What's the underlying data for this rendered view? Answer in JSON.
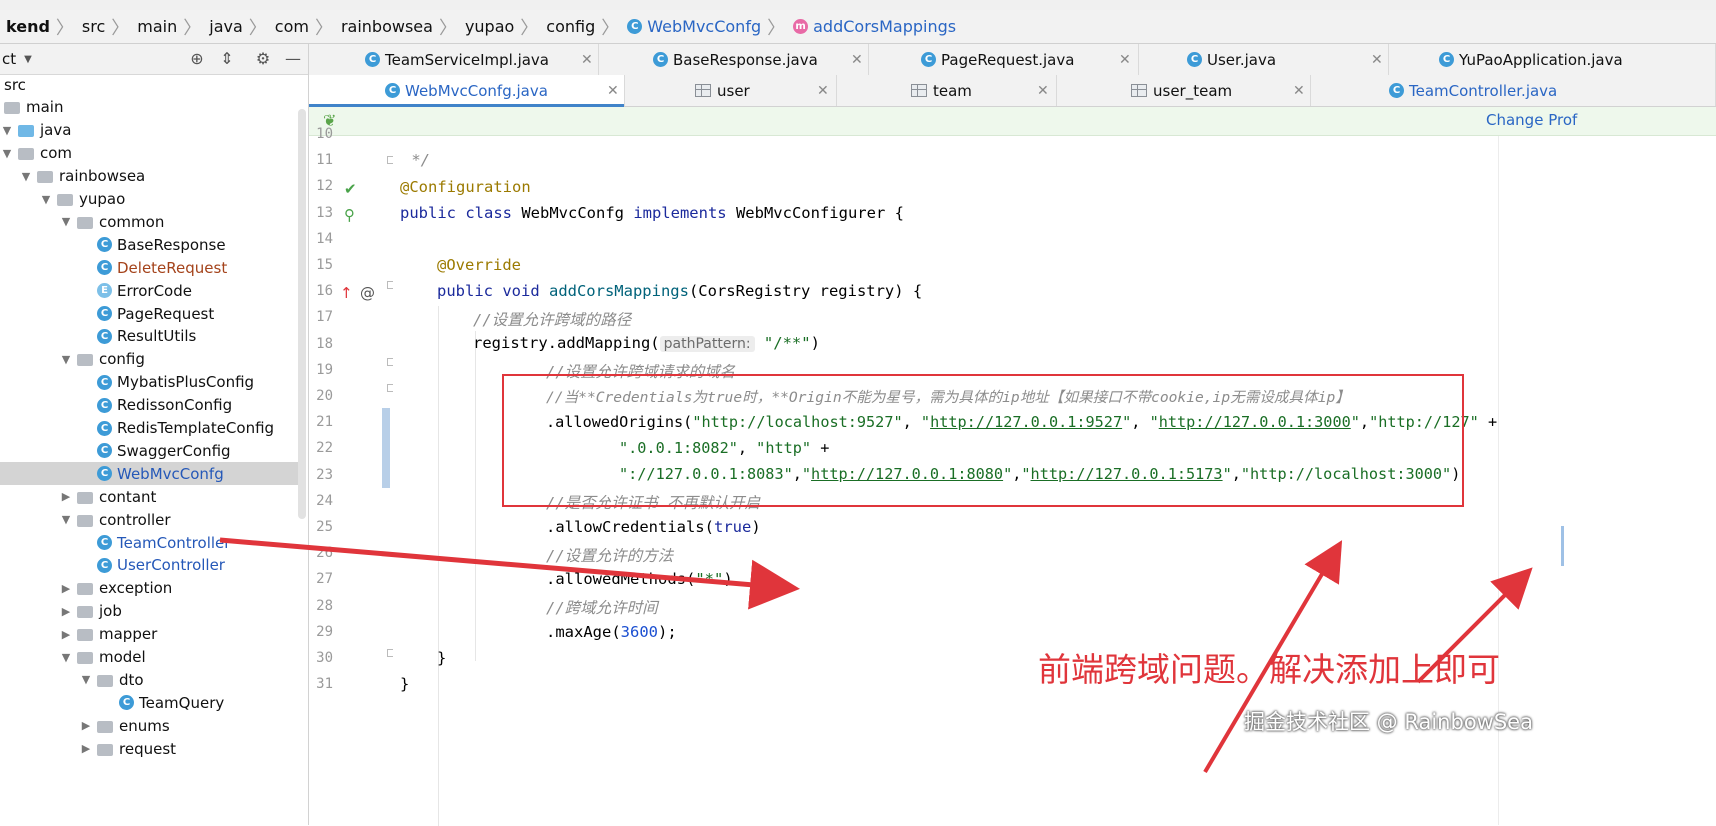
{
  "breadcrumb": {
    "items": [
      {
        "label": "kend",
        "icon": "none"
      },
      {
        "label": "src",
        "icon": "folder-icon"
      },
      {
        "label": "main",
        "icon": "none"
      },
      {
        "label": "java",
        "icon": "none"
      },
      {
        "label": "com",
        "icon": "none"
      },
      {
        "label": "rainbowsea",
        "icon": "none"
      },
      {
        "label": "yupao",
        "icon": "none"
      },
      {
        "label": "config",
        "icon": "none"
      },
      {
        "label": "WebMvcConfg",
        "icon": "class-icon"
      },
      {
        "label": "addCorsMappings",
        "icon": "method-icon"
      }
    ]
  },
  "project_panel": {
    "title": "ct",
    "tree": [
      {
        "label": "src",
        "depth": 0,
        "arrow": "",
        "icon": "none",
        "style": "normal"
      },
      {
        "label": "main",
        "depth": 0,
        "arrow": "",
        "icon": "folder",
        "style": "normal"
      },
      {
        "label": "java",
        "depth": 0,
        "arrow": "open",
        "icon": "folder-blue",
        "style": "normal"
      },
      {
        "label": "com",
        "depth": 1,
        "arrow": "open",
        "icon": "folder",
        "style": "normal"
      },
      {
        "label": "rainbowsea",
        "depth": 2,
        "arrow": "open",
        "icon": "folder",
        "style": "normal"
      },
      {
        "label": "yupao",
        "depth": 3,
        "arrow": "open",
        "icon": "folder",
        "style": "normal"
      },
      {
        "label": "common",
        "depth": 4,
        "arrow": "open",
        "icon": "folder",
        "style": "normal"
      },
      {
        "label": "BaseResponse",
        "depth": 5,
        "arrow": "",
        "icon": "class",
        "style": "normal"
      },
      {
        "label": "DeleteRequest",
        "depth": 5,
        "arrow": "",
        "icon": "class",
        "style": "brown"
      },
      {
        "label": "ErrorCode",
        "depth": 5,
        "arrow": "",
        "icon": "enum",
        "style": "normal"
      },
      {
        "label": "PageRequest",
        "depth": 5,
        "arrow": "",
        "icon": "class",
        "style": "normal"
      },
      {
        "label": "ResultUtils",
        "depth": 5,
        "arrow": "",
        "icon": "class",
        "style": "normal"
      },
      {
        "label": "config",
        "depth": 4,
        "arrow": "open",
        "icon": "folder",
        "style": "normal"
      },
      {
        "label": "MybatisPlusConfig",
        "depth": 5,
        "arrow": "",
        "icon": "class",
        "style": "normal"
      },
      {
        "label": "RedissonConfig",
        "depth": 5,
        "arrow": "",
        "icon": "class",
        "style": "normal"
      },
      {
        "label": "RedisTemplateConfig",
        "depth": 5,
        "arrow": "",
        "icon": "class",
        "style": "normal"
      },
      {
        "label": "SwaggerConfig",
        "depth": 5,
        "arrow": "",
        "icon": "class",
        "style": "normal"
      },
      {
        "label": "WebMvcConfg",
        "depth": 5,
        "arrow": "",
        "icon": "class",
        "style": "selected"
      },
      {
        "label": "contant",
        "depth": 4,
        "arrow": "closed",
        "icon": "folder",
        "style": "normal"
      },
      {
        "label": "controller",
        "depth": 4,
        "arrow": "open",
        "icon": "folder",
        "style": "normal"
      },
      {
        "label": "TeamController",
        "depth": 5,
        "arrow": "",
        "icon": "class",
        "style": "blue"
      },
      {
        "label": "UserController",
        "depth": 5,
        "arrow": "",
        "icon": "class",
        "style": "blue"
      },
      {
        "label": "exception",
        "depth": 4,
        "arrow": "closed",
        "icon": "folder",
        "style": "normal"
      },
      {
        "label": "job",
        "depth": 4,
        "arrow": "closed",
        "icon": "folder",
        "style": "normal"
      },
      {
        "label": "mapper",
        "depth": 4,
        "arrow": "closed",
        "icon": "folder",
        "style": "normal"
      },
      {
        "label": "model",
        "depth": 4,
        "arrow": "open",
        "icon": "folder",
        "style": "normal"
      },
      {
        "label": "dto",
        "depth": 5,
        "arrow": "open",
        "icon": "folder",
        "style": "normal"
      },
      {
        "label": "TeamQuery",
        "depth": 6,
        "arrow": "",
        "icon": "class",
        "style": "normal"
      },
      {
        "label": "enums",
        "depth": 5,
        "arrow": "closed",
        "icon": "folder",
        "style": "normal"
      },
      {
        "label": "request",
        "depth": 5,
        "arrow": "closed",
        "icon": "folder",
        "style": "normal"
      }
    ]
  },
  "tabs_row1": [
    {
      "label": "TeamServiceImpl.java",
      "icon": "class"
    },
    {
      "label": "BaseResponse.java",
      "icon": "class"
    },
    {
      "label": "PageRequest.java",
      "icon": "class"
    },
    {
      "label": "User.java",
      "icon": "class"
    },
    {
      "label": "YuPaoApplication.java",
      "icon": "class"
    }
  ],
  "tabs_row2": [
    {
      "label": "WebMvcConfg.java",
      "icon": "class",
      "active": true
    },
    {
      "label": "user",
      "icon": "table"
    },
    {
      "label": "team",
      "icon": "table"
    },
    {
      "label": "user_team",
      "icon": "table"
    },
    {
      "label": "TeamController.java",
      "icon": "class"
    }
  ],
  "notification": {
    "link": "Change Prof"
  },
  "code": {
    "line_numbers": [
      "10",
      "11",
      "12",
      "13",
      "14",
      "15",
      "16",
      "17",
      "18",
      "19",
      "20",
      "21",
      "22",
      "23",
      "24",
      "25",
      "26",
      "27",
      "28",
      "29",
      "30",
      "31"
    ],
    "lines": {
      "l11": " */",
      "l12": "@Configuration",
      "l13_a": "public class ",
      "l13_b": "WebMvcConfg ",
      "l13_c": "implements ",
      "l13_d": "WebMvcConfigurer {",
      "l15": "@Override",
      "l16_a": "public void ",
      "l16_b": "addCorsMappings",
      "l16_c": "(CorsRegistry registry) {",
      "l17": "//设置允许跨域的路径",
      "l18_a": "registry.addMapping(",
      "l18_hint": "pathPattern:",
      "l18_b": "\"/**\"",
      "l18_c": ")",
      "l19": "//设置允许跨域请求的域名",
      "l20": "//当**Credentials为true时，**Origin不能为星号，需为具体的ip地址【如果接口不带cookie,ip无需设成具体ip】",
      "l21_a": ".allowedOrigins(",
      "l21_s1": "\"http://localhost:9527\"",
      "l21_s2": "http://127.0.0.1:9527",
      "l21_s3": "http://127.0.0.1:3000",
      "l21_s4": "\"http://127\"",
      "l21_plus": " +",
      "l22_s": "\".0.0.1:8082\"",
      "l22_s2": "\"http\"",
      "l22_plus": " +",
      "l23_s1": "\"://127.0.0.1:8083\"",
      "l23_s2": "http://127.0.0.1:8080",
      "l23_s3": "http://127.0.0.1:5173",
      "l23_s4": "\"http://localhost:3000\"",
      "l23_end": ")",
      "l24": "//是否允许证书 不再默认开启",
      "l25_a": ".allowCredentials(",
      "l25_b": "true",
      "l25_c": ")",
      "l26": "//设置允许的方法",
      "l27_a": ".allowedMethods(",
      "l27_b": "\"*\"",
      "l27_c": ")",
      "l28": "//跨域允许时间",
      "l29_a": ".maxAge(",
      "l29_b": "3600",
      "l29_c": ");",
      "l30": "}",
      "l31": "}"
    }
  },
  "annotation": {
    "text": "前端跨域问题。解决添加上即可",
    "color": "#e0353b"
  },
  "watermark": "掘金技术社区 @ RainbowSea"
}
